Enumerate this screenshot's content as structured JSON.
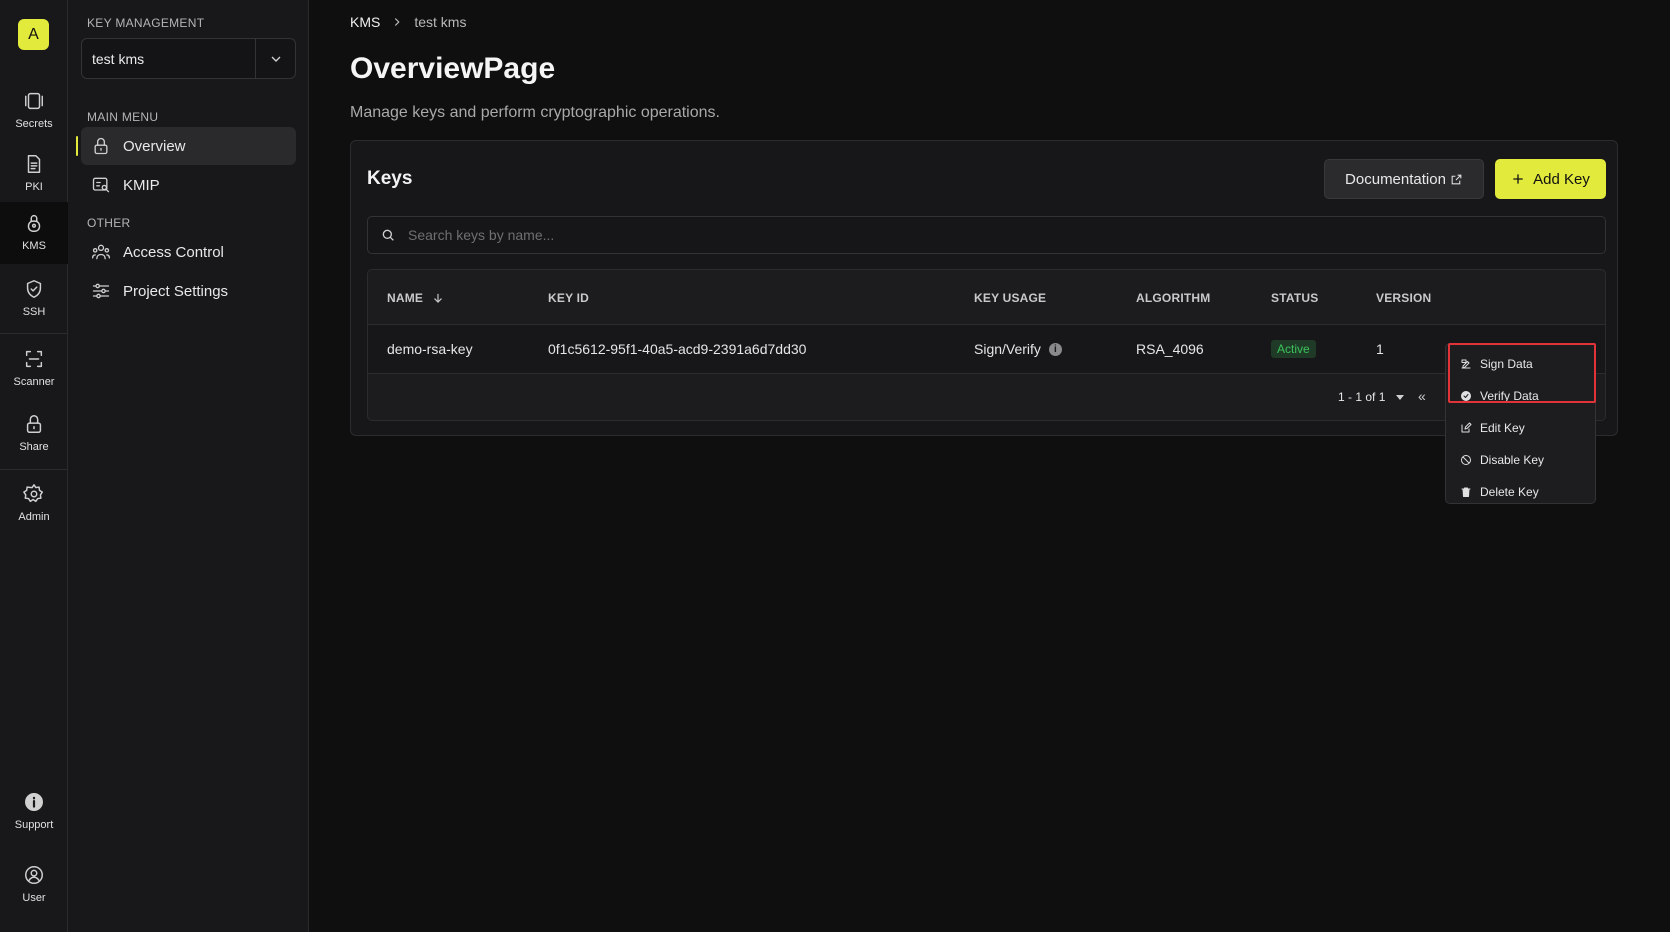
{
  "rail": {
    "org_initial": "A",
    "items": [
      {
        "label": "Secrets",
        "icon": "secrets-icon"
      },
      {
        "label": "PKI",
        "icon": "document-icon"
      },
      {
        "label": "KMS",
        "icon": "kms-lock-icon",
        "active": true
      },
      {
        "label": "SSH",
        "icon": "shield-icon"
      },
      {
        "label": "Scanner",
        "icon": "scan-icon"
      },
      {
        "label": "Share",
        "icon": "lock-icon"
      },
      {
        "label": "Admin",
        "icon": "gear-icon"
      }
    ],
    "bottom": [
      {
        "label": "Support",
        "icon": "info-icon"
      },
      {
        "label": "User",
        "icon": "user-icon"
      }
    ]
  },
  "sidebar": {
    "section_key_management": "KEY MANAGEMENT",
    "project_select": "test kms",
    "section_main_menu": "MAIN MENU",
    "main_items": [
      {
        "label": "Overview",
        "icon": "lock-icon",
        "active": true
      },
      {
        "label": "KMIP",
        "icon": "kmip-icon"
      }
    ],
    "section_other": "OTHER",
    "other_items": [
      {
        "label": "Access Control",
        "icon": "users-icon"
      },
      {
        "label": "Project Settings",
        "icon": "sliders-icon"
      }
    ]
  },
  "breadcrumb": {
    "root": "KMS",
    "current": "test kms"
  },
  "page": {
    "title": "OverviewPage",
    "subtitle": "Manage keys and perform cryptographic operations."
  },
  "keys_card": {
    "title": "Keys",
    "documentation_label": "Documentation",
    "add_key_label": "Add Key",
    "search_placeholder": "Search keys by name...",
    "columns": [
      "NAME",
      "KEY ID",
      "KEY USAGE",
      "ALGORITHM",
      "STATUS",
      "VERSION"
    ],
    "rows": [
      {
        "name": "demo-rsa-key",
        "key_id": "0f1c5612-95f1-40a5-acd9-2391a6d7dd30",
        "key_usage": "Sign/Verify",
        "algorithm": "RSA_4096",
        "status": "Active",
        "version": "1"
      }
    ],
    "pagination": "1 - 1 of 1"
  },
  "row_menu": {
    "items": [
      {
        "label": "Sign Data",
        "icon": "sign-icon"
      },
      {
        "label": "Verify Data",
        "icon": "check-circle-icon"
      },
      {
        "label": "Edit Key",
        "icon": "edit-icon"
      },
      {
        "label": "Disable Key",
        "icon": "disable-icon"
      },
      {
        "label": "Delete Key",
        "icon": "trash-icon"
      }
    ]
  },
  "colors": {
    "accent": "#e2ea3c",
    "background": "#0f0f10",
    "panel": "#18181a",
    "status_active": "#3cc35c",
    "highlight": "#e0343a"
  }
}
